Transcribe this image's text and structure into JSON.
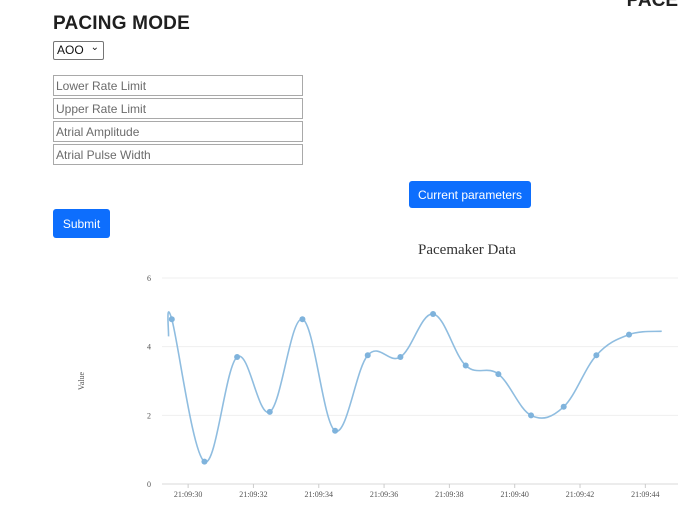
{
  "header": {
    "corner_text": "PACE",
    "title": "PACING MODE"
  },
  "form": {
    "mode_selected": "AOO",
    "fields": [
      {
        "placeholder": "Lower Rate Limit"
      },
      {
        "placeholder": "Upper Rate Limit"
      },
      {
        "placeholder": "Atrial Amplitude"
      },
      {
        "placeholder": "Atrial Pulse Width"
      }
    ],
    "submit_label": "Submit",
    "current_params_label": "Current parameters"
  },
  "colors": {
    "accent": "#0d6efd",
    "series": "#8fbde0",
    "point": "#7fb3dc"
  },
  "chart_data": {
    "type": "line",
    "title": "Pacemaker Data",
    "xlabel": "",
    "ylabel": "Value",
    "ylim": [
      0,
      6
    ],
    "yticks": [
      0,
      2,
      4,
      6
    ],
    "xlim": [
      29.2,
      45.0
    ],
    "xticks": [
      {
        "t": 30,
        "label": "21:09:30"
      },
      {
        "t": 32,
        "label": "21:09:32"
      },
      {
        "t": 34,
        "label": "21:09:34"
      },
      {
        "t": 36,
        "label": "21:09:36"
      },
      {
        "t": 38,
        "label": "21:09:38"
      },
      {
        "t": 40,
        "label": "21:09:40"
      },
      {
        "t": 42,
        "label": "21:09:42"
      },
      {
        "t": 44,
        "label": "21:09:44"
      }
    ],
    "series": [
      {
        "points": [
          {
            "t": 29.4,
            "v": 4.3,
            "marker": false
          },
          {
            "t": 29.5,
            "v": 4.8
          },
          {
            "t": 30.5,
            "v": 0.65
          },
          {
            "t": 31.5,
            "v": 3.7
          },
          {
            "t": 32.5,
            "v": 2.1
          },
          {
            "t": 33.5,
            "v": 4.8
          },
          {
            "t": 34.5,
            "v": 1.55
          },
          {
            "t": 35.5,
            "v": 3.75
          },
          {
            "t": 36.5,
            "v": 3.7
          },
          {
            "t": 37.5,
            "v": 4.95
          },
          {
            "t": 38.5,
            "v": 3.45
          },
          {
            "t": 39.5,
            "v": 3.2
          },
          {
            "t": 40.5,
            "v": 2.0
          },
          {
            "t": 41.5,
            "v": 2.25
          },
          {
            "t": 42.5,
            "v": 3.75
          },
          {
            "t": 43.5,
            "v": 4.35
          },
          {
            "t": 44.5,
            "v": 4.45,
            "marker": false
          }
        ]
      }
    ],
    "grid": true
  }
}
